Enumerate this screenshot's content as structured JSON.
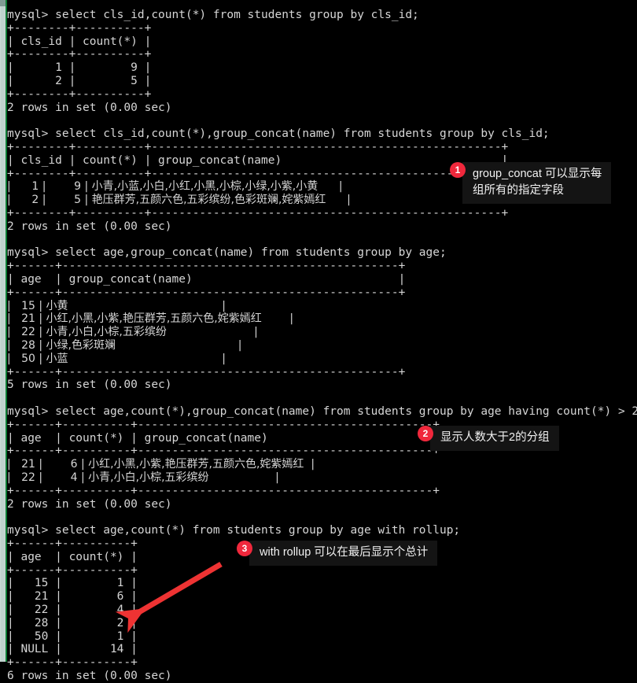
{
  "terminal": {
    "prompt": "mysql> ",
    "blocks": [
      {
        "id": "block-1",
        "command": "mysql> select cls_id,count(*) from students group by cls_id;",
        "lines": [
          "+--------+----------+",
          "| cls_id | count(*) |",
          "+--------+----------+",
          "|      1 |        9 |",
          "|      2 |        5 |",
          "+--------+----------+",
          "2 rows in set (0.00 sec)"
        ],
        "status": "2 rows in set (0.00 sec)"
      },
      {
        "id": "block-2",
        "command": "mysql> select cls_id,count(*),group_concat(name) from students group by cls_id;",
        "lines": [
          "+--------+----------+---------------------------------------------------+",
          "| cls_id | count(*) | group_concat(name)                                |",
          "+--------+----------+---------------------------------------------------+",
          "|      1 |        9 | 小青,小蓝,小白,小红,小黑,小棕,小绿,小紫,小黄      |",
          "|      2 |        5 | 艳压群芳,五颜六色,五彩缤纷,色彩斑斓,姹紫嫣红      |",
          "+--------+----------+---------------------------------------------------+",
          "2 rows in set (0.00 sec)"
        ],
        "status": "2 rows in set (0.00 sec)"
      },
      {
        "id": "block-3",
        "command": "mysql> select age,group_concat(name) from students group by age;",
        "lines": [
          "+------+-------------------------------------------------+",
          "| age  | group_concat(name)                              |",
          "+------+-------------------------------------------------+",
          "|   15 | 小黄                                            |",
          "|   21 | 小红,小黑,小紫,艳压群芳,五颜六色,姹紫嫣红        |",
          "|   22 | 小青,小白,小棕,五彩缤纷                         |",
          "|   28 | 小绿,色彩斑斓                                   |",
          "|   50 | 小蓝                                            |",
          "+------+-------------------------------------------------+",
          "5 rows in set (0.00 sec)"
        ],
        "status": "5 rows in set (0.00 sec)"
      },
      {
        "id": "block-4",
        "command": "mysql> select age,count(*),group_concat(name) from students group by age having count(*) > 2;",
        "lines": [
          "+------+----------+-------------------------------------------+",
          "| age  | count(*) | group_concat(name)                        |",
          "+------+----------+-------------------------------------------+",
          "|   21 |        6 | 小红,小黑,小紫,艳压群芳,五颜六色,姹紫嫣红  |",
          "|   22 |        4 | 小青,小白,小棕,五彩缤纷                   |",
          "+------+----------+-------------------------------------------+",
          "2 rows in set (0.00 sec)"
        ],
        "status": "2 rows in set (0.00 sec)"
      },
      {
        "id": "block-5",
        "command": "mysql> select age,count(*) from students group by age with rollup;",
        "lines": [
          "+------+----------+",
          "| age  | count(*) |",
          "+------+----------+",
          "|   15 |        1 |",
          "|   21 |        6 |",
          "|   22 |        4 |",
          "|   28 |        2 |",
          "|   50 |        1 |",
          "| NULL |       14 |",
          "+------+----------+",
          "6 rows in set (0.00 sec)"
        ],
        "status": "6 rows in set (0.00 sec)"
      }
    ],
    "result_tables": [
      {
        "columns": [
          "cls_id",
          "count(*)"
        ],
        "rows": [
          [
            "1",
            "9"
          ],
          [
            "2",
            "5"
          ]
        ]
      },
      {
        "columns": [
          "cls_id",
          "count(*)",
          "group_concat(name)"
        ],
        "rows": [
          [
            "1",
            "9",
            "小青,小蓝,小白,小红,小黑,小棕,小绿,小紫,小黄"
          ],
          [
            "2",
            "5",
            "艳压群芳,五颜六色,五彩缤纷,色彩斑斓,姹紫嫣红"
          ]
        ]
      },
      {
        "columns": [
          "age",
          "group_concat(name)"
        ],
        "rows": [
          [
            "15",
            "小黄"
          ],
          [
            "21",
            "小红,小黑,小紫,艳压群芳,五颜六色,姹紫嫣红"
          ],
          [
            "22",
            "小青,小白,小棕,五彩缤纷"
          ],
          [
            "28",
            "小绿,色彩斑斓"
          ],
          [
            "50",
            "小蓝"
          ]
        ]
      },
      {
        "columns": [
          "age",
          "count(*)",
          "group_concat(name)"
        ],
        "rows": [
          [
            "21",
            "6",
            "小红,小黑,小紫,艳压群芳,五颜六色,姹紫嫣红"
          ],
          [
            "22",
            "4",
            "小青,小白,小棕,五彩缤纷"
          ]
        ]
      },
      {
        "columns": [
          "age",
          "count(*)"
        ],
        "rows": [
          [
            "15",
            "1"
          ],
          [
            "21",
            "6"
          ],
          [
            "22",
            "4"
          ],
          [
            "28",
            "2"
          ],
          [
            "50",
            "1"
          ],
          [
            "NULL",
            "14"
          ]
        ]
      }
    ]
  },
  "annotations": [
    {
      "number": "1",
      "text": "group_concat 可以显示每\n组所有的指定字段"
    },
    {
      "number": "2",
      "text": "显示人数大于2的分组"
    },
    {
      "number": "3",
      "text": "with rollup 可以在最后显示个总计"
    }
  ],
  "colors": {
    "terminal_bg": "#000000",
    "terminal_fg": "#d6d6d6",
    "badge_red": "#f0283c",
    "callout_bg": "#141414",
    "arrow_red": "#ee3333",
    "rule_green": "#0b7a32",
    "scrollbar": "#c9d9d5"
  }
}
